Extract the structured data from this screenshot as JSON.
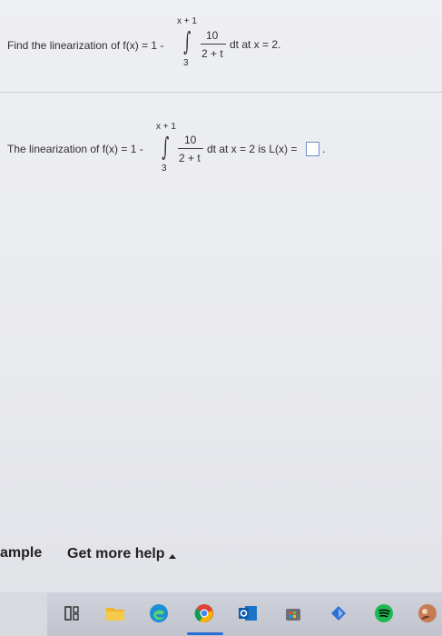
{
  "question": {
    "prompt": "Find the linearization of f(x) = 1 -",
    "upper_limit": "x + 1",
    "lower_limit": "3",
    "numerator": "10",
    "denominator": "2 + t",
    "suffix": "dt at x = 2."
  },
  "answer": {
    "prompt": "The linearization of f(x) = 1 -",
    "upper_limit": "x + 1",
    "lower_limit": "3",
    "numerator": "10",
    "denominator": "2 + t",
    "suffix": "dt at x = 2 is L(x) =",
    "end": "."
  },
  "footer": {
    "example_label": "ample",
    "help_label": "Get more help"
  },
  "taskbar": {
    "icons": [
      "task-view-icon",
      "file-explorer-icon",
      "edge-icon",
      "chrome-icon",
      "outlook-icon",
      "store-icon",
      "app-icon",
      "spotify-icon",
      "app2-icon"
    ]
  }
}
